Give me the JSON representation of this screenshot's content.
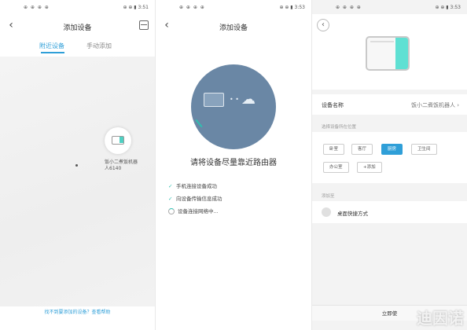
{
  "panel1": {
    "status_left": "⊕ ⊕ ⊕ ⊕",
    "status_right": "⊕ ⊕ ▮ 3:51",
    "title": "添加设备",
    "tabs": [
      {
        "label": "附近设备"
      },
      {
        "label": "手动添加"
      }
    ],
    "device_label": "饭小二煮饭机器人6140",
    "footer_link": "找不到要添加的设备？查看帮助"
  },
  "panel2": {
    "status_left": "⊕ ⊕ ⊕ ⊕",
    "status_right": "⊕ ⊕ ▮ 3:53",
    "title": "添加设备",
    "headline": "请将设备尽量靠近路由器",
    "steps": [
      {
        "mark": "✓",
        "label": "手机连接设备成功"
      },
      {
        "mark": "✓",
        "label": "向设备传输信息成功"
      },
      {
        "mark": "",
        "label": "设备连接网络中..."
      }
    ]
  },
  "panel3": {
    "status_left": "⊕ ⊕ ⊕ ⊕",
    "status_right": "⊕ ⊕ ▮ 3:53",
    "name_key": "设备名称",
    "name_value": "饭小二煮饭机器人 ›",
    "location_label": "选择设备所在位置",
    "rooms": [
      {
        "label": "卧室",
        "selected": false
      },
      {
        "label": "客厅",
        "selected": false
      },
      {
        "label": "厨房",
        "selected": true
      },
      {
        "label": "卫生间",
        "selected": false
      },
      {
        "label": "办公室",
        "selected": false
      },
      {
        "label": "+添加",
        "selected": false
      }
    ],
    "add_to_label": "添加至",
    "shortcut_label": "桌面快捷方式",
    "confirm": "立即使",
    "watermark": "迪因诺"
  },
  "colors": {
    "accent": "#2f9fd8",
    "teal": "#2fbfb0",
    "hero": "#6a87a5"
  }
}
